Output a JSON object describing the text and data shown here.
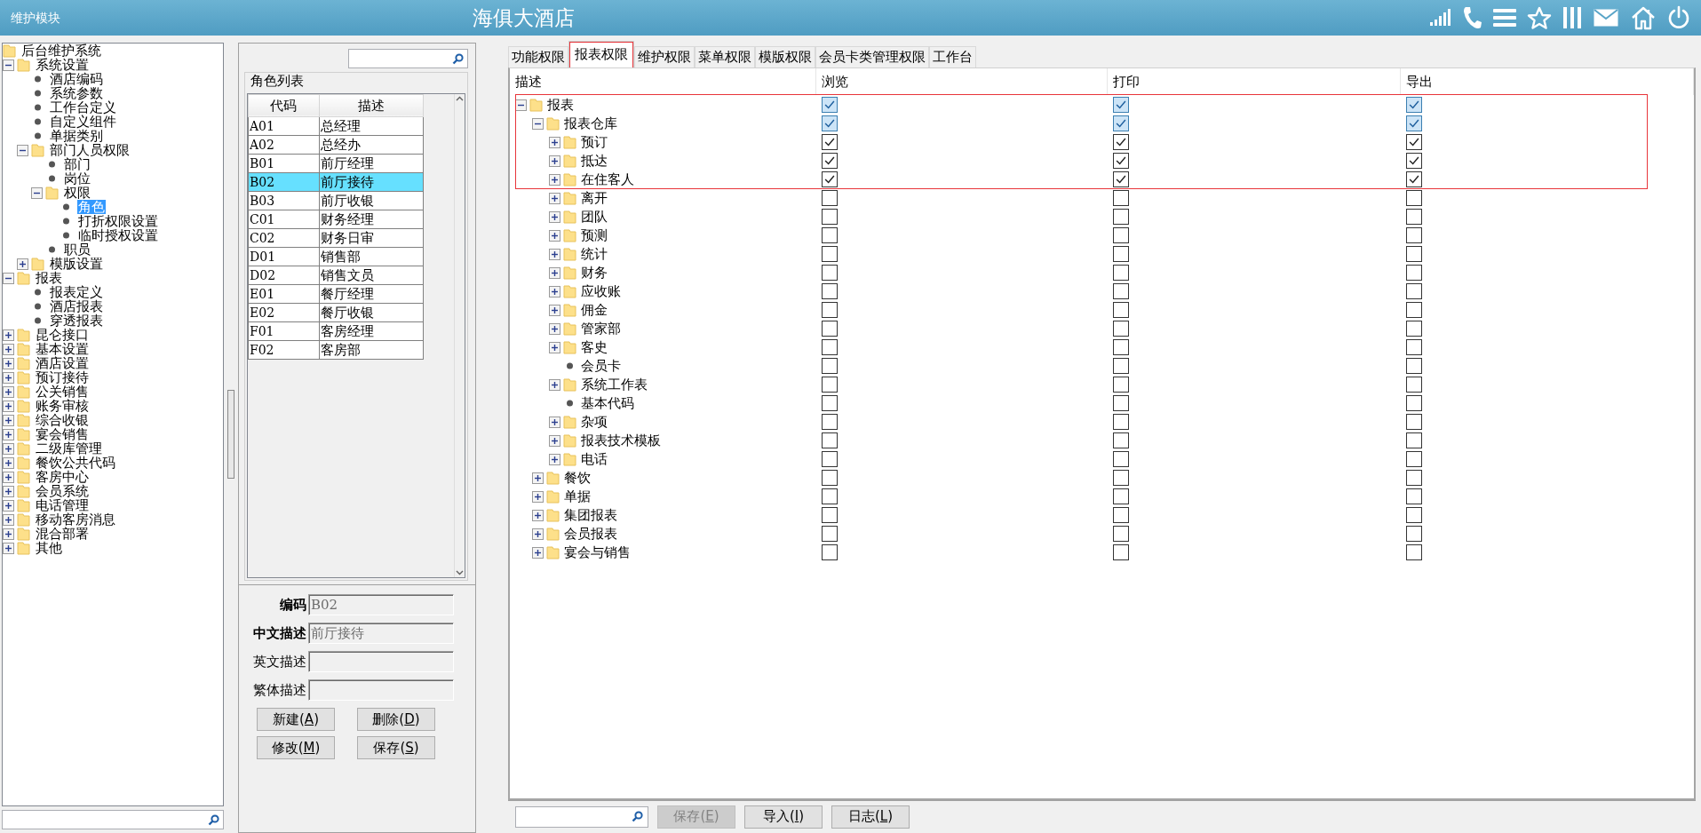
{
  "header": {
    "module": "维护模块",
    "title": "海俱大酒店"
  },
  "nav_tree": [
    {
      "label": "后台维护系统",
      "kind": "root",
      "selected": false,
      "children": [
        {
          "label": "系统设置",
          "kind": "folder",
          "expanded": true,
          "selected": false,
          "children": [
            {
              "label": "酒店编码",
              "kind": "leaf",
              "selected": false
            },
            {
              "label": "系统参数",
              "kind": "leaf",
              "selected": false
            },
            {
              "label": "工作台定义",
              "kind": "leaf",
              "selected": false
            },
            {
              "label": "自定义组件",
              "kind": "leaf",
              "selected": false
            },
            {
              "label": "单据类别",
              "kind": "leaf",
              "selected": false
            },
            {
              "label": "部门人员权限",
              "kind": "folder",
              "expanded": true,
              "selected": false,
              "children": [
                {
                  "label": "部门",
                  "kind": "leaf",
                  "selected": false
                },
                {
                  "label": "岗位",
                  "kind": "leaf",
                  "selected": false
                },
                {
                  "label": "权限",
                  "kind": "folder",
                  "expanded": true,
                  "selected": false,
                  "children": [
                    {
                      "label": "角色",
                      "kind": "leaf",
                      "selected": true
                    },
                    {
                      "label": "打折权限设置",
                      "kind": "leaf",
                      "selected": false
                    },
                    {
                      "label": "临时授权设置",
                      "kind": "leaf",
                      "selected": false
                    }
                  ]
                },
                {
                  "label": "职员",
                  "kind": "leaf",
                  "selected": false
                }
              ]
            },
            {
              "label": "模版设置",
              "kind": "folder",
              "expanded": false,
              "selected": false
            }
          ]
        },
        {
          "label": "报表",
          "kind": "folder",
          "expanded": true,
          "selected": false,
          "children": [
            {
              "label": "报表定义",
              "kind": "leaf",
              "selected": false
            },
            {
              "label": "酒店报表",
              "kind": "leaf",
              "selected": false
            },
            {
              "label": "穿透报表",
              "kind": "leaf",
              "selected": false
            }
          ]
        },
        {
          "label": "昆仑接口",
          "kind": "folder",
          "expanded": false,
          "selected": false
        },
        {
          "label": "基本设置",
          "kind": "folder",
          "expanded": false,
          "selected": false
        },
        {
          "label": "酒店设置",
          "kind": "folder",
          "expanded": false,
          "selected": false
        },
        {
          "label": "预订接待",
          "kind": "folder",
          "expanded": false,
          "selected": false
        },
        {
          "label": "公关销售",
          "kind": "folder",
          "expanded": false,
          "selected": false
        },
        {
          "label": "账务审核",
          "kind": "folder",
          "expanded": false,
          "selected": false
        },
        {
          "label": "综合收银",
          "kind": "folder",
          "expanded": false,
          "selected": false
        },
        {
          "label": "宴会销售",
          "kind": "folder",
          "expanded": false,
          "selected": false
        },
        {
          "label": "二级库管理",
          "kind": "folder",
          "expanded": false,
          "selected": false
        },
        {
          "label": "餐饮公共代码",
          "kind": "folder",
          "expanded": false,
          "selected": false
        },
        {
          "label": "客房中心",
          "kind": "folder",
          "expanded": false,
          "selected": false
        },
        {
          "label": "会员系统",
          "kind": "folder",
          "expanded": false,
          "selected": false
        },
        {
          "label": "电话管理",
          "kind": "folder",
          "expanded": false,
          "selected": false
        },
        {
          "label": "移动客房消息",
          "kind": "folder",
          "expanded": false,
          "selected": false
        },
        {
          "label": "混合部署",
          "kind": "folder",
          "expanded": false,
          "selected": false
        },
        {
          "label": "其他",
          "kind": "folder",
          "expanded": false,
          "selected": false
        }
      ]
    }
  ],
  "roles": {
    "title": "角色列表",
    "columns": [
      "代码",
      "描述"
    ],
    "rows": [
      {
        "code": "A01",
        "description": "总经理",
        "selected": false
      },
      {
        "code": "A02",
        "description": "总经办",
        "selected": false
      },
      {
        "code": "B01",
        "description": "前厅经理",
        "selected": false
      },
      {
        "code": "B02",
        "description": "前厅接待",
        "selected": true
      },
      {
        "code": "B03",
        "description": "前厅收银",
        "selected": false
      },
      {
        "code": "C01",
        "description": "财务经理",
        "selected": false
      },
      {
        "code": "C02",
        "description": "财务日审",
        "selected": false
      },
      {
        "code": "D01",
        "description": "销售部",
        "selected": false
      },
      {
        "code": "D02",
        "description": "销售文员",
        "selected": false
      },
      {
        "code": "E01",
        "description": "餐厅经理",
        "selected": false
      },
      {
        "code": "E02",
        "description": "餐厅收银",
        "selected": false
      },
      {
        "code": "F01",
        "description": "客房经理",
        "selected": false
      },
      {
        "code": "F02",
        "description": "客房部",
        "selected": false
      }
    ]
  },
  "role_form": {
    "fields": [
      {
        "label": "编码",
        "value": "B02",
        "required": true
      },
      {
        "label": "中文描述",
        "value": "前厅接待",
        "required": true
      },
      {
        "label": "英文描述",
        "required": false
      },
      {
        "label": "繁体描述",
        "required": false
      }
    ],
    "buttons": [
      {
        "before": "新建(",
        "hotkey": "A",
        "after": ")"
      },
      {
        "before": "删除(",
        "hotkey": "D",
        "after": ")"
      },
      {
        "before": "修改(",
        "hotkey": "M",
        "after": ")"
      },
      {
        "before": "保存(",
        "hotkey": "S",
        "after": ")"
      }
    ]
  },
  "tabs": [
    {
      "label": "功能权限",
      "selected": false,
      "outlined": false
    },
    {
      "label": "报表权限",
      "selected": true,
      "outlined": true
    },
    {
      "label": "维护权限",
      "selected": false,
      "outlined": false
    },
    {
      "label": "菜单权限",
      "selected": false,
      "outlined": false
    },
    {
      "label": "模版权限",
      "selected": false,
      "outlined": false
    },
    {
      "label": "会员卡类管理权限",
      "selected": false,
      "outlined": false
    },
    {
      "label": "工作台",
      "selected": false,
      "outlined": false
    }
  ],
  "report_grid": {
    "columns": [
      "描述",
      "浏览",
      "打印",
      "导出"
    ],
    "rows": [
      {
        "label": "报表",
        "kind": "folder",
        "expanded": true,
        "highlighted": true,
        "outlined": true,
        "browse": true,
        "print": true,
        "export": true,
        "children": [
          {
            "label": "报表仓库",
            "kind": "folder",
            "expanded": true,
            "highlighted": true,
            "outlined": true,
            "browse": true,
            "print": true,
            "export": true,
            "children": [
              {
                "label": "预订",
                "kind": "folder",
                "expanded": false,
                "highlighted": false,
                "outlined": true,
                "browse": true,
                "print": true,
                "export": true
              },
              {
                "label": "抵达",
                "kind": "folder",
                "expanded": false,
                "highlighted": false,
                "outlined": true,
                "browse": true,
                "print": true,
                "export": true
              },
              {
                "label": "在住客人",
                "kind": "folder",
                "expanded": false,
                "highlighted": false,
                "outlined": true,
                "browse": true,
                "print": true,
                "export": true
              },
              {
                "label": "离开",
                "kind": "folder",
                "expanded": false,
                "highlighted": false,
                "outlined": false,
                "browse": false,
                "print": false,
                "export": false
              },
              {
                "label": "团队",
                "kind": "folder",
                "expanded": false,
                "highlighted": false,
                "outlined": false,
                "browse": false,
                "print": false,
                "export": false
              },
              {
                "label": "预测",
                "kind": "folder",
                "expanded": false,
                "highlighted": false,
                "outlined": false,
                "browse": false,
                "print": false,
                "export": false
              },
              {
                "label": "统计",
                "kind": "folder",
                "expanded": false,
                "highlighted": false,
                "outlined": false,
                "browse": false,
                "print": false,
                "export": false
              },
              {
                "label": "财务",
                "kind": "folder",
                "expanded": false,
                "highlighted": false,
                "outlined": false,
                "browse": false,
                "print": false,
                "export": false
              },
              {
                "label": "应收账",
                "kind": "folder",
                "expanded": false,
                "highlighted": false,
                "outlined": false,
                "browse": false,
                "print": false,
                "export": false
              },
              {
                "label": "佣金",
                "kind": "folder",
                "expanded": false,
                "highlighted": false,
                "outlined": false,
                "browse": false,
                "print": false,
                "export": false
              },
              {
                "label": "管家部",
                "kind": "folder",
                "expanded": false,
                "highlighted": false,
                "outlined": false,
                "browse": false,
                "print": false,
                "export": false
              },
              {
                "label": "客史",
                "kind": "folder",
                "expanded": false,
                "highlighted": false,
                "outlined": false,
                "browse": false,
                "print": false,
                "export": false
              },
              {
                "label": "会员卡",
                "kind": "leaf",
                "highlighted": false,
                "outlined": false,
                "browse": false,
                "print": false,
                "export": false
              },
              {
                "label": "系统工作表",
                "kind": "folder",
                "expanded": false,
                "highlighted": false,
                "outlined": false,
                "browse": false,
                "print": false,
                "export": false
              },
              {
                "label": "基本代码",
                "kind": "leaf",
                "highlighted": false,
                "outlined": false,
                "browse": false,
                "print": false,
                "export": false
              },
              {
                "label": "杂项",
                "kind": "folder",
                "expanded": false,
                "highlighted": false,
                "outlined": false,
                "browse": false,
                "print": false,
                "export": false
              },
              {
                "label": "报表技术模板",
                "kind": "folder",
                "expanded": false,
                "highlighted": false,
                "outlined": false,
                "browse": false,
                "print": false,
                "export": false
              },
              {
                "label": "电话",
                "kind": "folder",
                "expanded": false,
                "highlighted": false,
                "outlined": false,
                "browse": false,
                "print": false,
                "export": false
              }
            ]
          },
          {
            "label": "餐饮",
            "kind": "folder",
            "expanded": false,
            "highlighted": false,
            "outlined": false,
            "browse": false,
            "print": false,
            "export": false
          },
          {
            "label": "单据",
            "kind": "folder",
            "expanded": false,
            "highlighted": false,
            "outlined": false,
            "browse": false,
            "print": false,
            "export": false
          },
          {
            "label": "集团报表",
            "kind": "folder",
            "expanded": false,
            "highlighted": false,
            "outlined": false,
            "browse": false,
            "print": false,
            "export": false
          },
          {
            "label": "会员报表",
            "kind": "folder",
            "expanded": false,
            "highlighted": false,
            "outlined": false,
            "browse": false,
            "print": false,
            "export": false
          },
          {
            "label": "宴会与销售",
            "kind": "folder",
            "expanded": false,
            "highlighted": false,
            "outlined": false,
            "browse": false,
            "print": false,
            "export": false
          }
        ]
      }
    ]
  },
  "footer_buttons": [
    {
      "before": "保存(",
      "hotkey": "E",
      "after": ")",
      "disabled": true
    },
    {
      "before": "导入(",
      "hotkey": "I",
      "after": ")",
      "disabled": false
    },
    {
      "before": "日志(",
      "hotkey": "L",
      "after": ")",
      "disabled": false
    }
  ]
}
